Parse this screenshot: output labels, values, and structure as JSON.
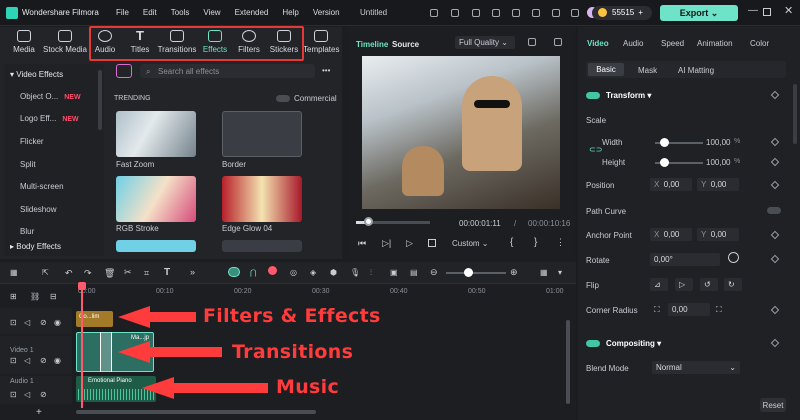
{
  "app": {
    "title": "Wondershare Filmora",
    "project": "Untitled",
    "credits": "55515",
    "export_label": "Export"
  },
  "menu": [
    "File",
    "Edit",
    "Tools",
    "View",
    "Extended",
    "Help",
    "Version"
  ],
  "library_tabs": [
    "Media",
    "Stock Media",
    "Audio",
    "Titles",
    "Transitions",
    "Effects",
    "Filters",
    "Stickers",
    "Templates"
  ],
  "sidebar": {
    "header": "Video Effects",
    "items": [
      "Object O...",
      "Logo Eff...",
      "Flicker",
      "Split",
      "Multi-screen",
      "Slideshow",
      "Blur"
    ],
    "new_label": "NEW",
    "footer": "Body Effects"
  },
  "search": {
    "placeholder": "Search all effects"
  },
  "section": {
    "label": "TRENDING",
    "toggle_label": "Commercial"
  },
  "effects": [
    {
      "name": "Fast Zoom"
    },
    {
      "name": "Border"
    },
    {
      "name": "RGB Stroke"
    },
    {
      "name": "Edge Glow 04"
    }
  ],
  "player": {
    "tabs": [
      "Timeline",
      "Source"
    ],
    "quality": "Full Quality",
    "current_time": "00:00:01:11",
    "total_time": "00:00:10:16",
    "zoom_label": "Custom"
  },
  "properties": {
    "tabs": [
      "Video",
      "Audio",
      "Speed",
      "Animation",
      "Color"
    ],
    "subtabs": [
      "Basic",
      "Mask",
      "AI Matting"
    ],
    "transform": "Transform",
    "scale": "Scale",
    "width_label": "Width",
    "width_value": "100,00",
    "width_unit": "%",
    "height_label": "Height",
    "height_value": "100,00",
    "height_unit": "%",
    "position": "Position",
    "pos_x_label": "X",
    "pos_x": "0,00",
    "pos_y_label": "Y",
    "pos_y": "0,00",
    "path_curve": "Path Curve",
    "anchor": "Anchor Point",
    "anchor_x": "0,00",
    "anchor_y": "0,00",
    "rotate": "Rotate",
    "rotate_value": "0,00°",
    "flip": "Flip",
    "corner": "Corner Radius",
    "corner_value": "0,00",
    "compositing": "Compositing",
    "blend": "Blend Mode",
    "blend_value": "Normal",
    "reset": "Reset"
  },
  "timeline": {
    "ruler": [
      "00:00",
      "00:10",
      "00:20",
      "00:30",
      "00:40",
      "00:50",
      "01:00"
    ],
    "tracks": [
      "Video 1",
      "Audio 1"
    ],
    "clips": {
      "effect": "Co...lim",
      "video": "Ma...jp",
      "audio": "Emotional Piano"
    }
  },
  "annotations": {
    "a1": "Filters & Effects",
    "a2": "Transitions",
    "a3": "Music"
  },
  "colors": {
    "accent": "#6fe3c7",
    "highlight": "#e53935",
    "annotation": "#ff3b3b",
    "new_badge": "#ff4d6d"
  }
}
